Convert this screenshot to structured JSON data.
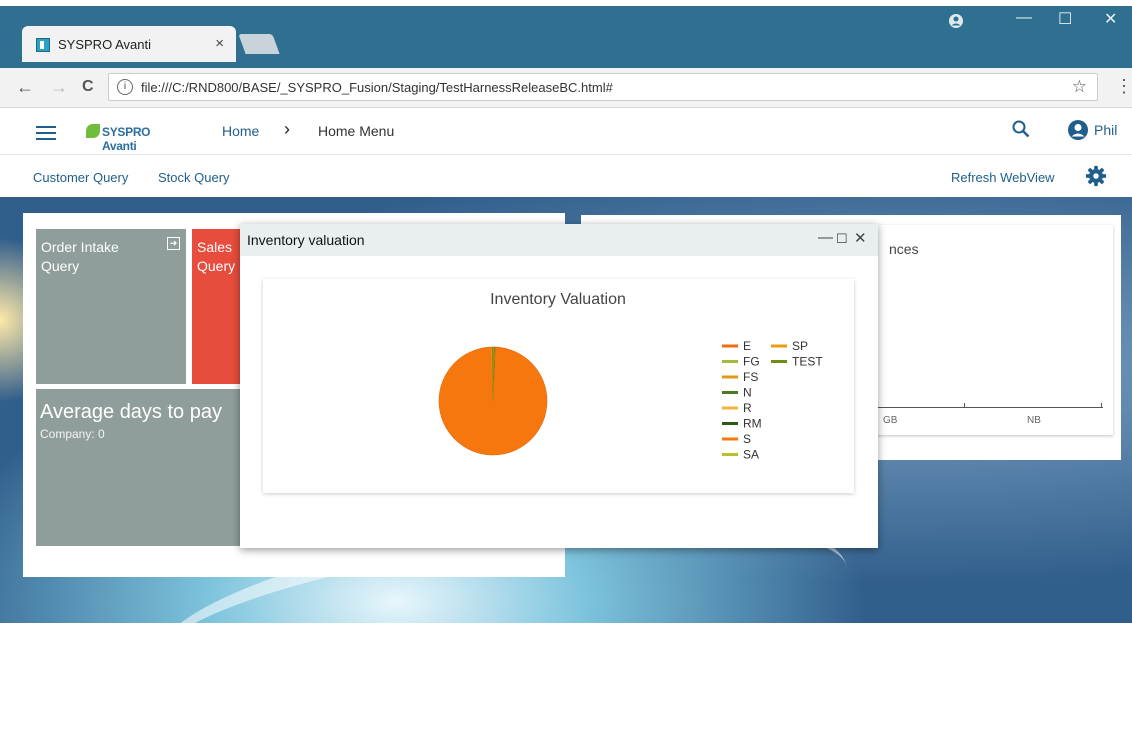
{
  "browser": {
    "tab_title": "SYSPRO Avanti",
    "tab_close": "×",
    "url": "file:///C:/RND800/BASE/_SYSPRO_Fusion/Staging/TestHarnessReleaseBC.html#",
    "info": "i",
    "win_minimize": "—",
    "win_maximize": "☐",
    "win_close": "✕",
    "back": "←",
    "forward": "→",
    "reload": "C",
    "star": "☆",
    "menu": "⋮"
  },
  "app": {
    "logo_text": "SYSPRO Avanti",
    "breadcrumb_home": "Home",
    "breadcrumb_sep": "›",
    "breadcrumb_current": "Home Menu",
    "user_name": "Phil"
  },
  "toolbar": {
    "customer_query": "Customer Query",
    "stock_query": "Stock Query",
    "refresh_webview": "Refresh WebView"
  },
  "tiles": {
    "order_intake": "Order Intake Query",
    "sales_query": "Sales Query",
    "avg_days": "Average days to pay",
    "avg_days_company": "Company: 0"
  },
  "right_panel": {
    "title_fragment": "nces",
    "x_labels": [
      "GB",
      "NB"
    ]
  },
  "dialog": {
    "title": "Inventory valuation",
    "minimize": "—",
    "maximize": "☐",
    "close": "✕"
  },
  "chart_data": {
    "type": "pie",
    "title": "Inventory Valuation",
    "legend_placement": "right",
    "series": [
      {
        "name": "E",
        "value": 0.2,
        "color": "#f26b0f"
      },
      {
        "name": "FG",
        "value": 0.1,
        "color": "#9ebd3c"
      },
      {
        "name": "FS",
        "value": 0.1,
        "color": "#e8950f"
      },
      {
        "name": "N",
        "value": 0.1,
        "color": "#4c7a1f"
      },
      {
        "name": "R",
        "value": 0.1,
        "color": "#f2b63c"
      },
      {
        "name": "RM",
        "value": 0.1,
        "color": "#2d5a14"
      },
      {
        "name": "S",
        "value": 98.9,
        "color": "#f5770e"
      },
      {
        "name": "SA",
        "value": 0.1,
        "color": "#bcc028"
      },
      {
        "name": "SP",
        "value": 0.1,
        "color": "#f09a12"
      },
      {
        "name": "TEST",
        "value": 0.2,
        "color": "#6b8f12"
      }
    ]
  }
}
